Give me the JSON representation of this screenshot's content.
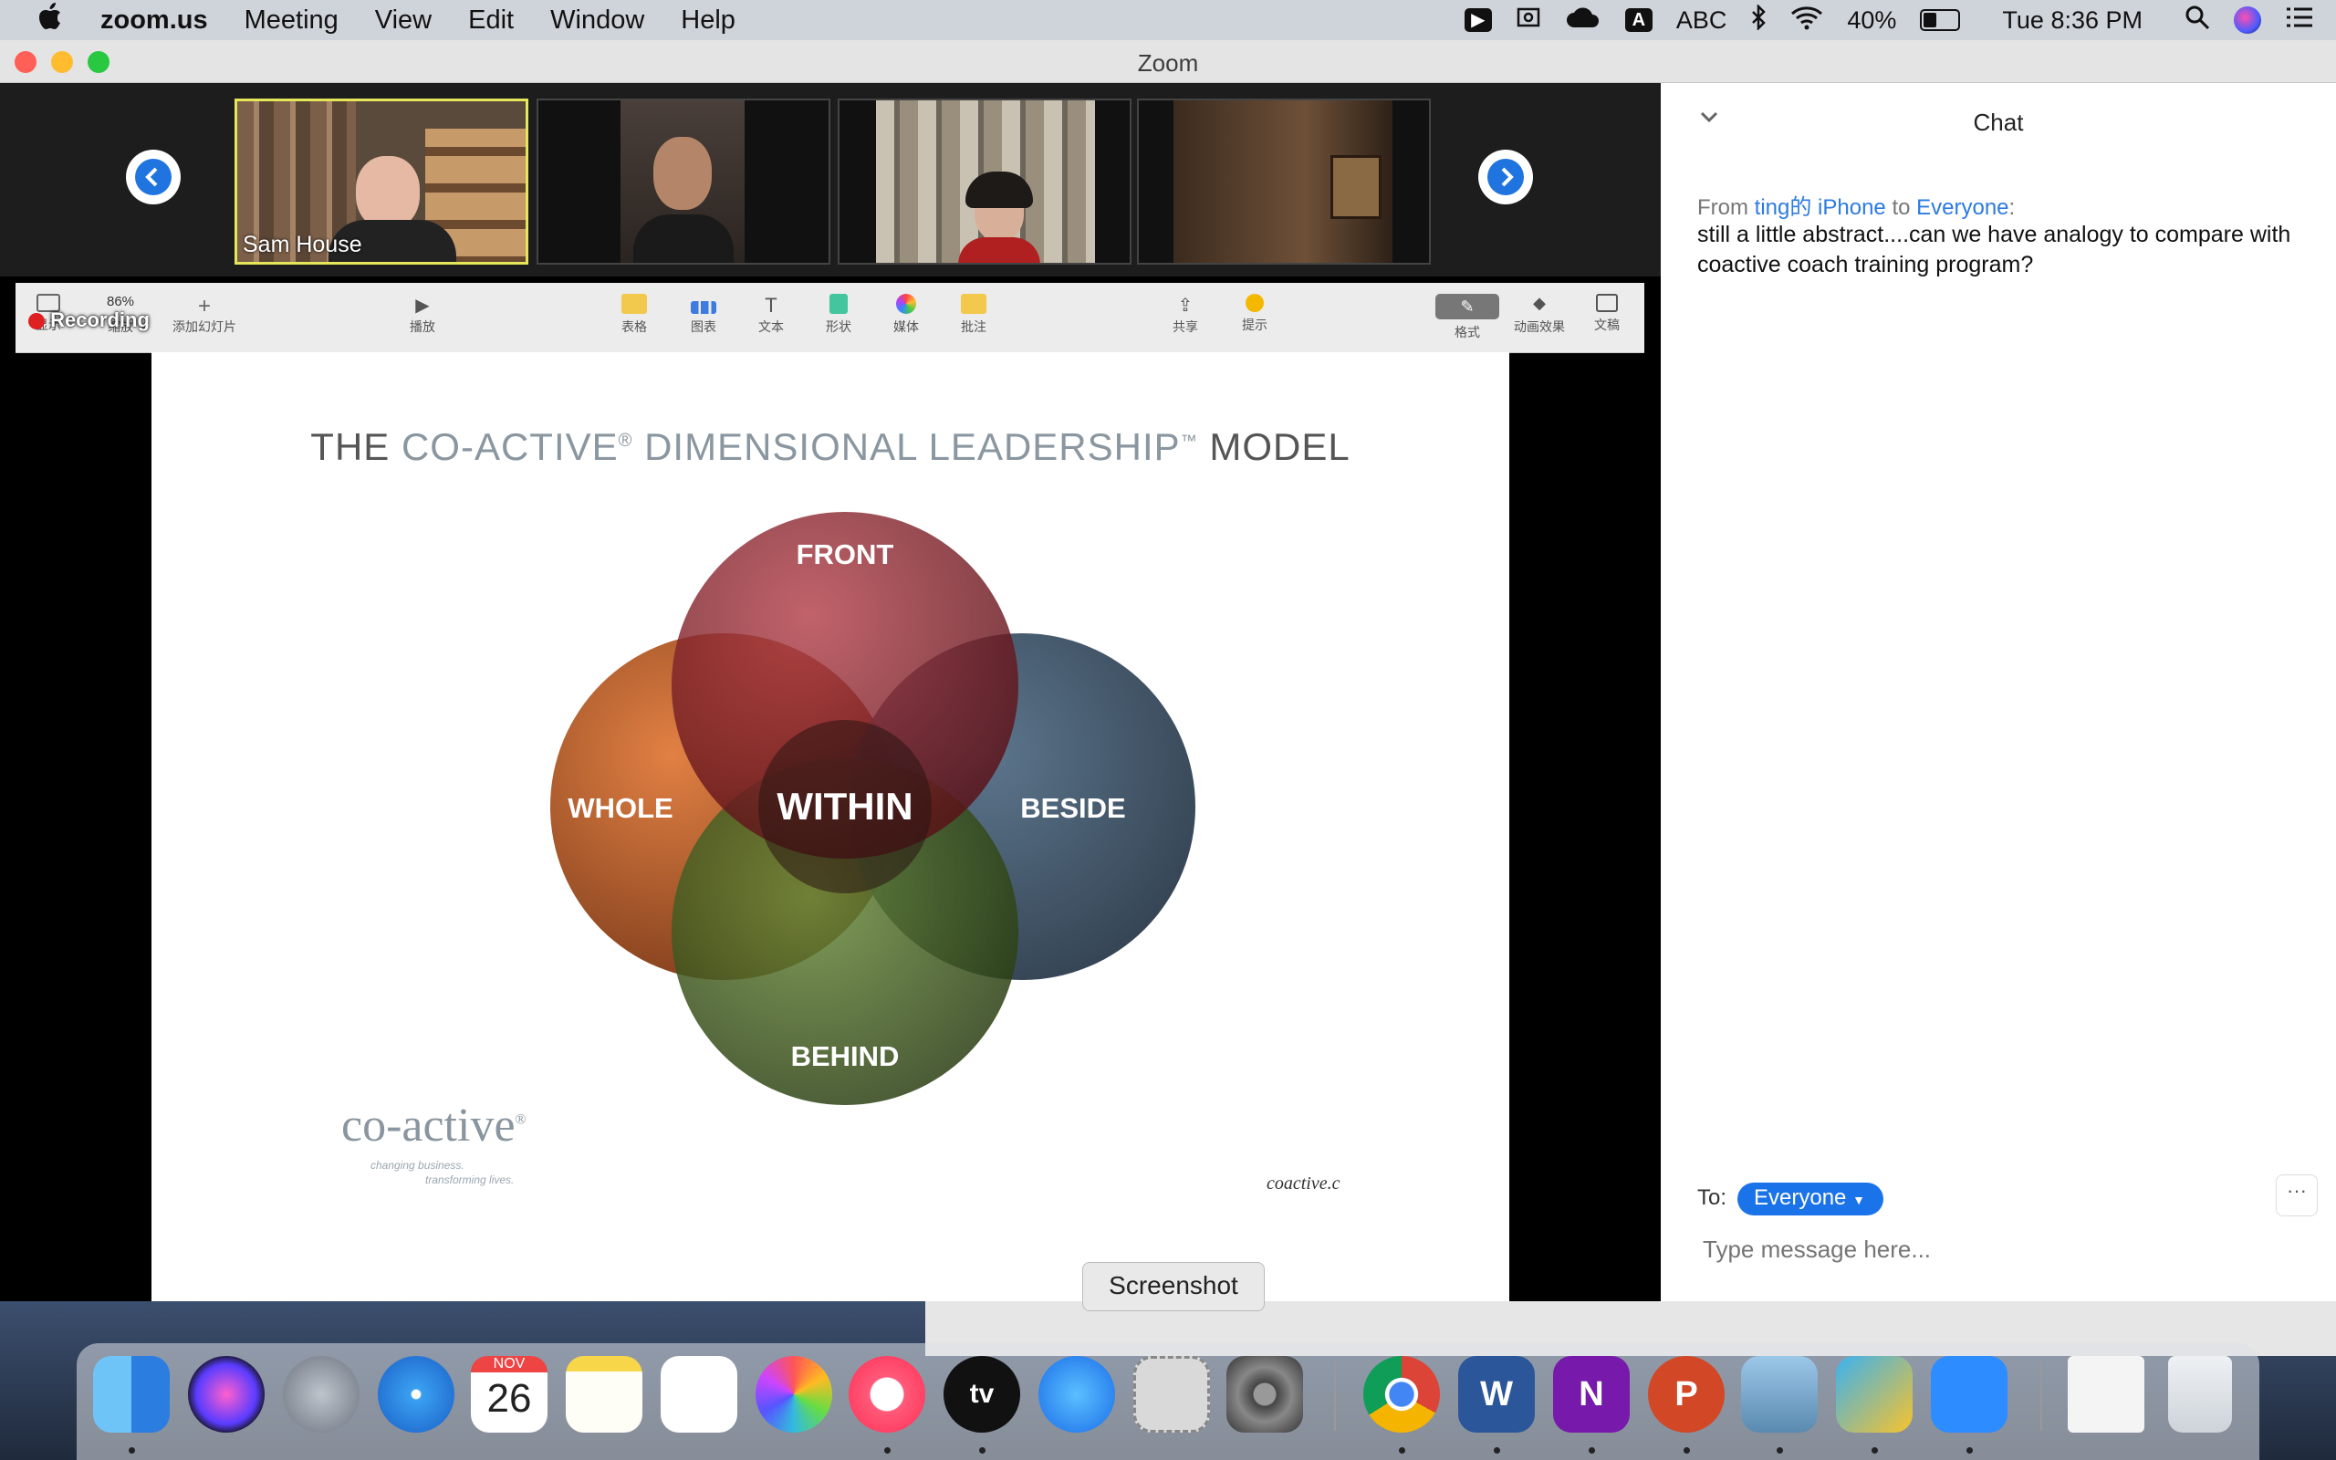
{
  "menubar": {
    "app_name": "zoom.us",
    "items": [
      "Meeting",
      "View",
      "Edit",
      "Window",
      "Help"
    ],
    "input_source": "ABC",
    "battery": "40%",
    "clock": "Tue 8:36 PM"
  },
  "window": {
    "title": "Zoom"
  },
  "participants": [
    {
      "name": "Sam House",
      "active": true
    },
    {
      "name": ""
    },
    {
      "name": ""
    },
    {
      "name": ""
    }
  ],
  "recording_label": "Recording",
  "keynote_toolbar": {
    "zoom_level": "86%",
    "left": [
      "显示",
      "缩放",
      "添加幻灯片"
    ],
    "play": "播放",
    "center": [
      "表格",
      "图表",
      "文本",
      "形状",
      "媒体",
      "批注"
    ],
    "share": "共享",
    "tips": "提示",
    "right": [
      "格式",
      "动画效果",
      "文稿"
    ]
  },
  "slide": {
    "title_pre": "THE ",
    "title_acc1": "CO-ACTIVE",
    "title_reg": "®",
    "title_acc2": " DIMENSIONAL LEADERSHIP",
    "title_tm": "™",
    "title_post": " MODEL",
    "circles": {
      "front": "FRONT",
      "whole": "WHOLE",
      "within": "WITHIN",
      "beside": "BESIDE",
      "behind": "BEHIND"
    },
    "logo": "co-active",
    "logo_r": "®",
    "tagline1": "changing business.",
    "tagline2": "transforming lives.",
    "footer": "coactive.c"
  },
  "chat": {
    "header": "Chat",
    "from_label": "From",
    "sender": "ting的 iPhone",
    "to_word": "to",
    "recipient": "Everyone",
    "colon": ":",
    "message": "still a little abstract....can we have analogy to compare with coactive coach training program?",
    "to_label": "To:",
    "to_value": "Everyone",
    "placeholder": "Type message here...",
    "more": "···"
  },
  "tooltip": "Screenshot",
  "dock": {
    "calendar_month": "NOV",
    "calendar_day": "26",
    "appletv": "tv",
    "word": "W",
    "onenote": "N",
    "powerpoint": "P"
  },
  "colors": {
    "accent": "#1a73e8",
    "front": "#7a1a22",
    "beside": "#2e4155",
    "behind": "#3c5a23",
    "whole": "#b0521b"
  }
}
